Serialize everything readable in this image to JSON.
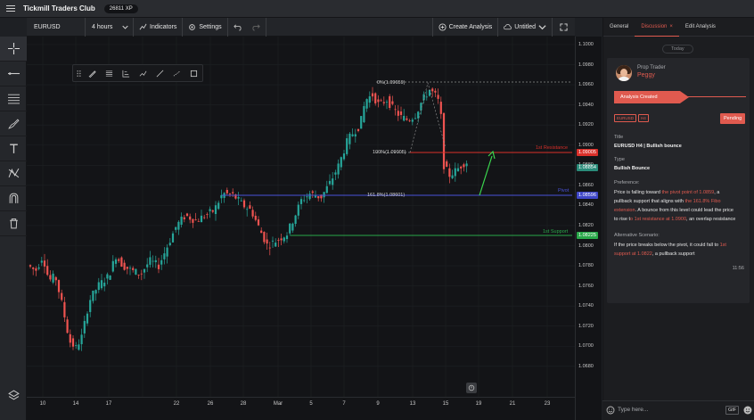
{
  "app": {
    "brand": "Tickmill Traders Club",
    "xp_badge": "26811 XP"
  },
  "chart_header": {
    "symbol": "EURUSD",
    "interval": "4 hours",
    "indicators_label": "Indicators",
    "settings_label": "Settings",
    "create_analysis_label": "Create Analysis",
    "layout_name": "Untitled"
  },
  "left_tools": [
    "crosshair-icon",
    "trend-line-icon",
    "fib-retracement-icon",
    "brush-icon",
    "text-icon",
    "pattern-icon",
    "magnet-icon",
    "trash-icon",
    "layers-icon"
  ],
  "drawing_tools": [
    "drag-handle-icon",
    "brush-icon",
    "horizontal-lines-icon",
    "long-position-icon",
    "path-icon",
    "ray-icon",
    "extended-line-icon",
    "rectangle-icon"
  ],
  "price_axis": {
    "labels": [
      "1.1000",
      "1.0980",
      "1.0960",
      "1.0940",
      "1.0920",
      "1.0900",
      "1.0880",
      "1.0860",
      "1.0840",
      "1.0820",
      "1.0800",
      "1.0780",
      "1.0760",
      "1.0740",
      "1.0720",
      "1.0700",
      "1.0680"
    ],
    "markers": [
      {
        "value": "1.09005",
        "color": "#d9302a"
      },
      {
        "value": "1.08854",
        "color": "#2a8c7a"
      },
      {
        "value": "1.08596",
        "color": "#3f47c8"
      },
      {
        "value": "1.08225",
        "color": "#2aa84a"
      }
    ]
  },
  "time_axis": [
    "10",
    "14",
    "17",
    "22",
    "26",
    "28",
    "Mar",
    "5",
    "7",
    "9",
    "13",
    "15",
    "19",
    "21",
    "23"
  ],
  "annotations": {
    "fib_0": "0%(1.09659)",
    "fib_100": "100%(1.09005)",
    "fib_1618": "161.8%(1.08601)",
    "resistance": "1st Resistance",
    "pivot": "Pivot",
    "support": "1st Support"
  },
  "chart_data": {
    "type": "candlestick",
    "symbol": "EURUSD",
    "interval": "4 hours",
    "ylim": [
      1.068,
      1.1
    ],
    "levels": [
      {
        "name": "1st Resistance",
        "value": 1.09005
      },
      {
        "name": "Pivot",
        "value": 1.08596
      },
      {
        "name": "1st Support",
        "value": 1.08225
      }
    ],
    "fibonacci": [
      {
        "label": "0%",
        "value": 1.09659
      },
      {
        "label": "100%",
        "value": 1.09005
      },
      {
        "label": "161.8%",
        "value": 1.08601
      }
    ],
    "last_price": 1.08854
  },
  "panel": {
    "tabs": [
      "General",
      "Discussion",
      "Edit Analysis"
    ],
    "today": "Today",
    "role": "Prop Trader",
    "user": "Peggy",
    "banner": "Analysis Created",
    "tags": [
      "EURUSD",
      "H4"
    ],
    "status": "Pending",
    "title_label": "Title",
    "title_value": "EURUSD H4 | Bullish bounce",
    "type_label": "Type",
    "type_value": "Bullish Bounce",
    "pref_label": "Preference:",
    "pref": {
      "t1": "Price is falling toward ",
      "h1": "the pivot point of 1.0859",
      "t2": ", a pullback support that aligns with ",
      "h2": "the 161.8% Fibo extension",
      "t3": ". A bounce from this level could lead the price to rise t",
      "h3": "o 1st resistance at 1.0900",
      "t4": ", an overlap resistance"
    },
    "alt_label": "Alternative Scenario:",
    "alt": {
      "t1": "If the price breaks below the pivot, it could fall to ",
      "h1": "1st support at 1.0822",
      "t2": ", a pullback support"
    },
    "time": "11:56",
    "input_placeholder": "Type here...",
    "gif_label": "GIF"
  }
}
